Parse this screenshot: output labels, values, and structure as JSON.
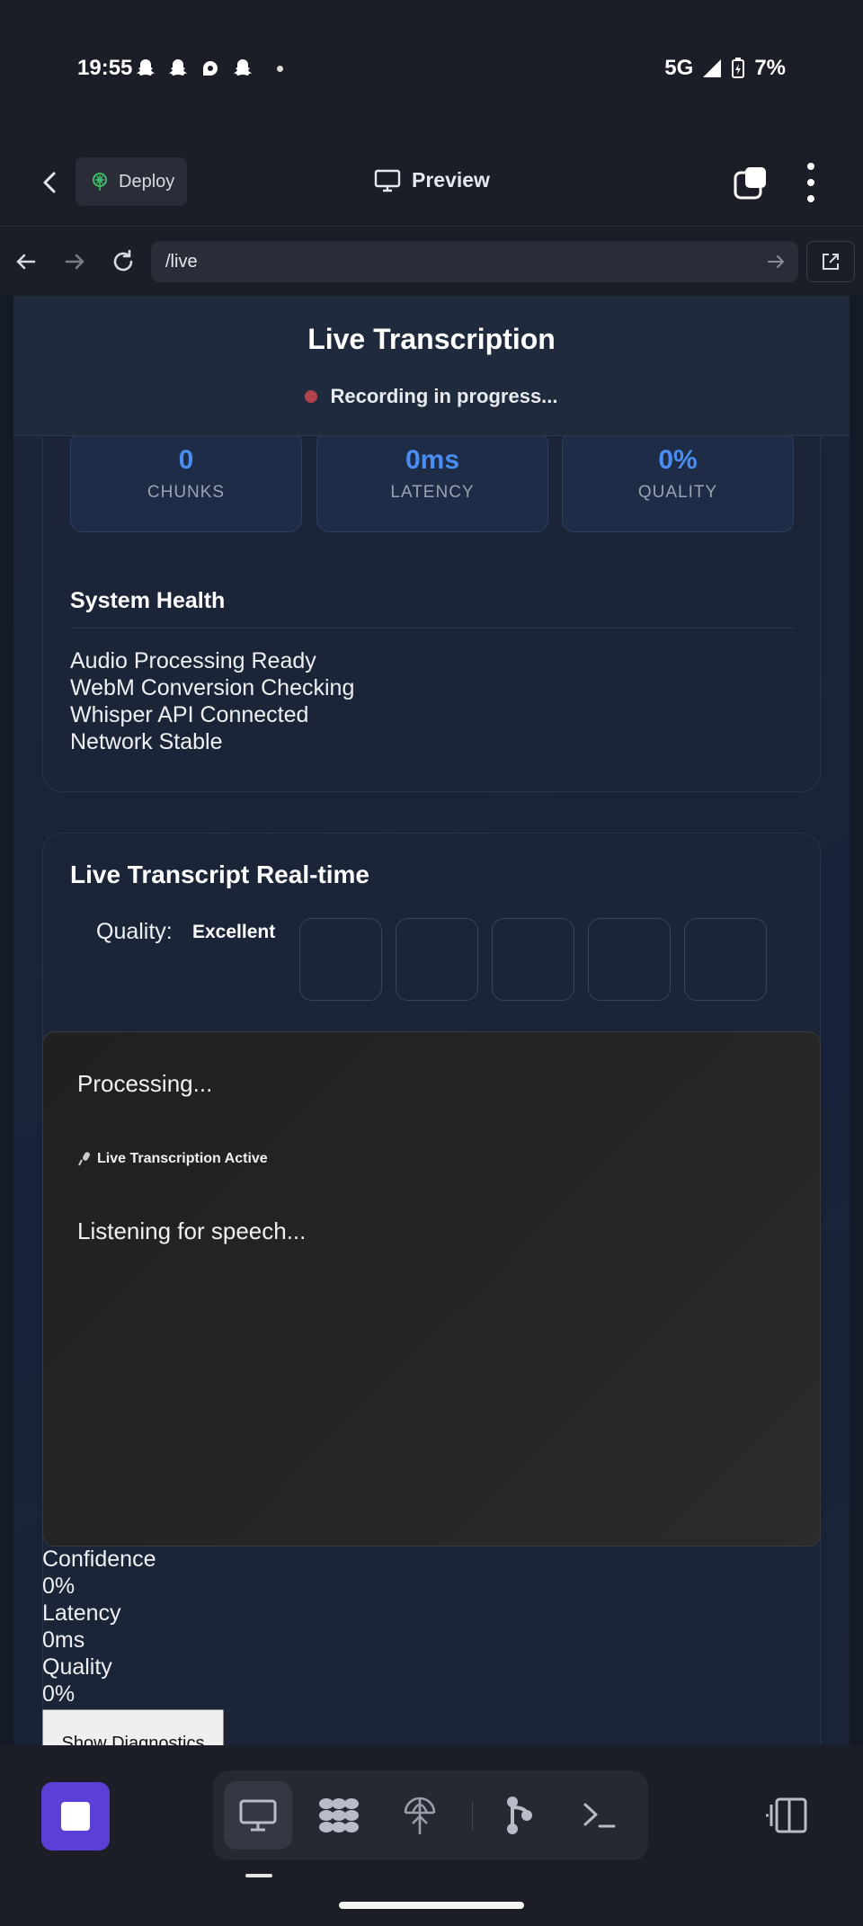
{
  "status_bar": {
    "time": "19:55",
    "notification_icons": [
      "snapchat-icon",
      "snapchat-icon",
      "threads-icon",
      "snapchat-icon"
    ],
    "network": "5G",
    "battery": "7%"
  },
  "header": {
    "deploy_label": "Deploy",
    "preview_label": "Preview"
  },
  "browser": {
    "url": "/live"
  },
  "page": {
    "title": "Live Transcription",
    "recording_status": "Recording in progress...",
    "stats": [
      {
        "value": "0",
        "label": "CHUNKS"
      },
      {
        "value": "0ms",
        "label": "LATENCY"
      },
      {
        "value": "0%",
        "label": "QUALITY"
      }
    ],
    "system_health": {
      "title": "System Health",
      "items": [
        "Audio Processing Ready",
        "WebM Conversion Checking",
        "Whisper API Connected",
        "Network Stable"
      ]
    },
    "transcript": {
      "title": "Live Transcript Real-time",
      "quality_label": "Quality:",
      "quality_value": "Excellent",
      "processing_text": "Processing...",
      "active_label": "Live Transcription Active",
      "listening_text": "Listening for speech..."
    },
    "metrics": [
      {
        "label": "Confidence",
        "value": "0%"
      },
      {
        "label": "Latency",
        "value": "0ms"
      },
      {
        "label": "Quality",
        "value": "0%"
      }
    ],
    "diagnostics_button": "Show Diagnostics"
  },
  "bottom_bar": {
    "tools": [
      "preview-icon",
      "agents-icon",
      "deploy-icon",
      "git-icon",
      "shell-icon"
    ],
    "active_tool": "preview-icon"
  },
  "colors": {
    "accent_blue": "#4a8df0",
    "recording_red": "#b2434d",
    "stop_purple": "#5b3fd6"
  }
}
